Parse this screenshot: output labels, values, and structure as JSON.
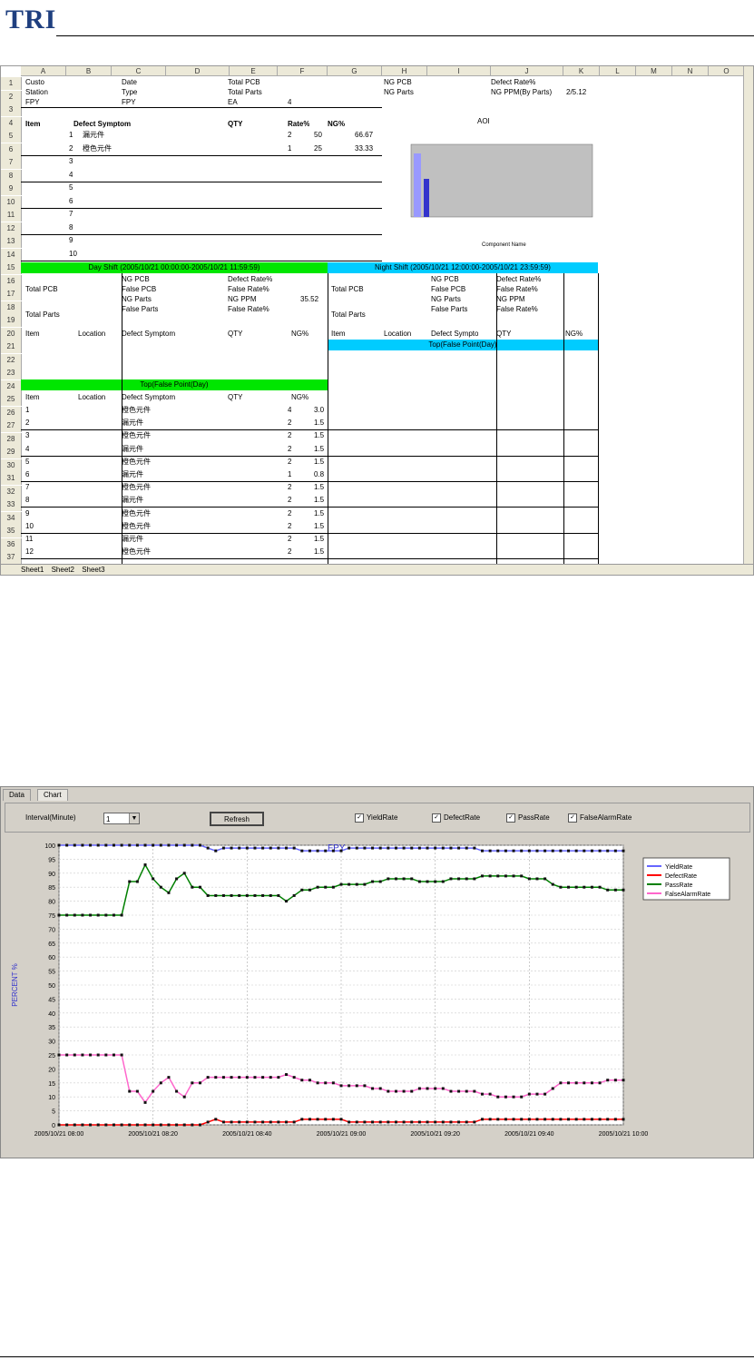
{
  "header": {
    "logo_text": "TRI"
  },
  "sheet": {
    "columns": [
      "A",
      "B",
      "C",
      "D",
      "E",
      "F",
      "G",
      "H",
      "I",
      "J",
      "K",
      "L",
      "M",
      "N",
      "O"
    ],
    "rows": [
      "1",
      "2",
      "3",
      "4",
      "5",
      "6",
      "7",
      "8",
      "9",
      "10",
      "11",
      "12",
      "13",
      "14",
      "15",
      "16",
      "17",
      "18",
      "19",
      "20",
      "21",
      "22",
      "23",
      "24",
      "25",
      "26",
      "27",
      "28",
      "29",
      "30",
      "31",
      "32",
      "33",
      "34",
      "35",
      "36",
      "37"
    ],
    "top": {
      "customer_label": "Custo",
      "station_label": "Station",
      "fpy_label": "FPY",
      "date_label": "Date",
      "type_label": "Type",
      "fpy2_label": "FPY",
      "total_pcb_label": "Total PCB",
      "total_parts_label": "Total Parts",
      "ea_label": "EA",
      "ea_value": "4",
      "ng_pcb_label": "NG PCB",
      "ng_parts_label": "NG Parts",
      "defect_rate_label": "Defect Rate%",
      "ng_ppm_label": "NG PPM(By Parts)",
      "ng_ppm_value": "2/5.12",
      "aoi_label": "AOI"
    },
    "defect_table": {
      "headers": [
        "Item",
        "Defect Symptom",
        "QTY",
        "Rate%",
        "NG%"
      ],
      "rows": [
        [
          "1",
          "漏元件",
          "2",
          "50",
          "66.67"
        ],
        [
          "2",
          "橙色元件",
          "1",
          "25",
          "33.33"
        ],
        [
          "3",
          "",
          "",
          "",
          ""
        ],
        [
          "4",
          "",
          "",
          "",
          ""
        ],
        [
          "5",
          "",
          "",
          "",
          ""
        ],
        [
          "6",
          "",
          "",
          "",
          ""
        ],
        [
          "7",
          "",
          "",
          "",
          ""
        ],
        [
          "8",
          "",
          "",
          "",
          ""
        ],
        [
          "9",
          "",
          "",
          "",
          ""
        ],
        [
          "10",
          "",
          "",
          "",
          ""
        ]
      ]
    },
    "mini_chart": {
      "title": "AOI NG",
      "xlabel": "Component Name"
    },
    "day_shift": {
      "title": "Day Shift   (2005/10/21 00:00:00-2005/10/21 11:59:59)",
      "total_pcb_label": "Total PCB",
      "total_parts_label": "Total Parts",
      "ng_pcb_label": "NG PCB",
      "false_pcb_label": "False PCB",
      "ng_parts_label": "NG Parts",
      "false_parts_label": "False Parts",
      "defect_rate_label": "Defect Rate%",
      "false_rate_label": "False Rate%",
      "ng_ppm_label": "NG PPM",
      "false_rate2_label": "False Rate%",
      "ng_ppm_value": "35.52"
    },
    "night_shift": {
      "title": "Night Shift  (2005/10/21 12:00:00-2005/10/21 23:59:59)",
      "total_pcb_label": "Total PCB",
      "total_parts_label": "Total Parts",
      "ng_pcb_label": "NG PCB",
      "false_pcb_label": "False PCB",
      "ng_parts_label": "NG Parts",
      "false_parts_label": "False Parts",
      "defect_rate_label": "Defect Rate%",
      "false_rate_label": "False Rate%",
      "ng_ppm_label": "NG PPM",
      "false_rate2_label": "False Rate%"
    },
    "shift_table_headers": [
      "Item",
      "Location",
      "Defect Symptom",
      "QTY",
      "NG%"
    ],
    "night_table_headers": [
      "Item",
      "Location",
      "Defect Sympto",
      "QTY",
      "NG%"
    ],
    "top_false_night": "Top(False Point(Day)",
    "top_false_day": "Top(False Point(Day)",
    "false_headers": [
      "Item",
      "Location",
      "Defect Symptom",
      "QTY",
      "NG%"
    ],
    "false_rows": [
      [
        "1",
        "",
        "橙色元件",
        "4",
        "",
        "3.0"
      ],
      [
        "2",
        "",
        "漏元件",
        "2",
        "",
        "1.5"
      ],
      [
        "3",
        "",
        "橙色元件",
        "2",
        "",
        "1.5"
      ],
      [
        "4",
        "",
        "漏元件",
        "2",
        "",
        "1.5"
      ],
      [
        "5",
        "",
        "橙色元件",
        "2",
        "",
        "1.5"
      ],
      [
        "6",
        "",
        "漏元件",
        "1",
        "",
        "0.8"
      ],
      [
        "7",
        "",
        "橙色元件",
        "2",
        "",
        "1.5"
      ],
      [
        "8",
        "",
        "漏元件",
        "2",
        "",
        "1.5"
      ],
      [
        "9",
        "",
        "橙色元件",
        "2",
        "",
        "1.5"
      ],
      [
        "10",
        "",
        "橙色元件",
        "2",
        "",
        "1.5"
      ],
      [
        "11",
        "",
        "漏元件",
        "2",
        "",
        "1.5"
      ],
      [
        "12",
        "",
        "橙色元件",
        "2",
        "",
        "1.5"
      ]
    ],
    "sheet_tabs": [
      "Sheet1",
      "Sheet2",
      "Sheet3"
    ]
  },
  "app": {
    "tabs": [
      "Data",
      "Chart"
    ],
    "interval_label": "Interval(Minute)",
    "interval_value": "1",
    "refresh_label": "Refresh",
    "checks": [
      {
        "label": "YieldRate",
        "checked": true
      },
      {
        "label": "DefectRate",
        "checked": true
      },
      {
        "label": "PassRate",
        "checked": true
      },
      {
        "label": "FalseAlarmRate",
        "checked": true
      }
    ]
  },
  "chart_data": {
    "type": "line",
    "title": "FPY",
    "ylabel": "PERCENT %",
    "ylim": [
      0,
      100
    ],
    "yticks": [
      0,
      5,
      10,
      15,
      20,
      25,
      30,
      35,
      40,
      45,
      50,
      55,
      60,
      65,
      70,
      75,
      80,
      85,
      90,
      95,
      100
    ],
    "x_tick_labels": [
      "2005/10/21 08:00",
      "2005/10/21 08:20",
      "2005/10/21 08:40",
      "2005/10/21 09:00",
      "2005/10/21 09:20",
      "2005/10/21 09:40",
      "2005/10/21 10:00"
    ],
    "grid": true,
    "legend_position": "top-right",
    "colors": {
      "YieldRate": "#6666ff",
      "DefectRate": "#ff0000",
      "PassRate": "#008000",
      "FalseAlarmRate": "#ff66cc"
    },
    "series": [
      {
        "name": "YieldRate",
        "values": [
          100,
          100,
          100,
          100,
          100,
          100,
          100,
          100,
          100,
          100,
          100,
          100,
          100,
          100,
          100,
          100,
          100,
          100,
          100,
          99,
          98,
          99,
          99,
          99,
          99,
          99,
          99,
          99,
          99,
          99,
          99,
          98,
          98,
          98,
          98,
          98,
          98,
          99,
          99,
          99,
          99,
          99,
          99,
          99,
          99,
          99,
          99,
          99,
          99,
          99,
          99,
          99,
          99,
          99,
          98,
          98,
          98,
          98,
          98,
          98,
          98,
          98,
          98,
          98,
          98,
          98,
          98,
          98,
          98,
          98,
          98,
          98,
          98
        ]
      },
      {
        "name": "DefectRate",
        "values": [
          0,
          0,
          0,
          0,
          0,
          0,
          0,
          0,
          0,
          0,
          0,
          0,
          0,
          0,
          0,
          0,
          0,
          0,
          0,
          1,
          2,
          1,
          1,
          1,
          1,
          1,
          1,
          1,
          1,
          1,
          1,
          2,
          2,
          2,
          2,
          2,
          2,
          1,
          1,
          1,
          1,
          1,
          1,
          1,
          1,
          1,
          1,
          1,
          1,
          1,
          1,
          1,
          1,
          1,
          2,
          2,
          2,
          2,
          2,
          2,
          2,
          2,
          2,
          2,
          2,
          2,
          2,
          2,
          2,
          2,
          2,
          2,
          2
        ]
      },
      {
        "name": "PassRate",
        "values": [
          75,
          75,
          75,
          75,
          75,
          75,
          75,
          75,
          75,
          87,
          87,
          93,
          88,
          85,
          83,
          88,
          90,
          85,
          85,
          82,
          82,
          82,
          82,
          82,
          82,
          82,
          82,
          82,
          82,
          80,
          82,
          84,
          84,
          85,
          85,
          85,
          86,
          86,
          86,
          86,
          87,
          87,
          88,
          88,
          88,
          88,
          87,
          87,
          87,
          87,
          88,
          88,
          88,
          88,
          89,
          89,
          89,
          89,
          89,
          89,
          88,
          88,
          88,
          86,
          85,
          85,
          85,
          85,
          85,
          85,
          84,
          84,
          84
        ]
      },
      {
        "name": "FalseAlarmRate",
        "values": [
          25,
          25,
          25,
          25,
          25,
          25,
          25,
          25,
          25,
          12,
          12,
          8,
          12,
          15,
          17,
          12,
          10,
          15,
          15,
          17,
          17,
          17,
          17,
          17,
          17,
          17,
          17,
          17,
          17,
          18,
          17,
          16,
          16,
          15,
          15,
          15,
          14,
          14,
          14,
          14,
          13,
          13,
          12,
          12,
          12,
          12,
          13,
          13,
          13,
          13,
          12,
          12,
          12,
          12,
          11,
          11,
          10,
          10,
          10,
          10,
          11,
          11,
          11,
          13,
          15,
          15,
          15,
          15,
          15,
          15,
          16,
          16,
          16
        ]
      }
    ]
  }
}
